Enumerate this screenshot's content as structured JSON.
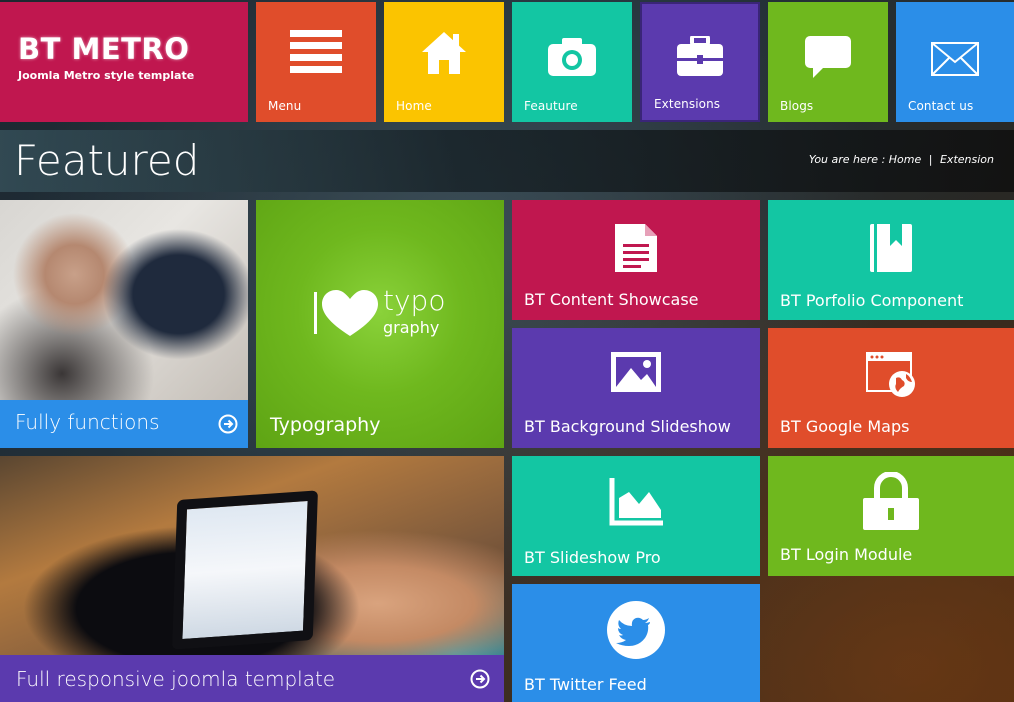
{
  "brand": {
    "title": "BT METRO",
    "subtitle": "Joomla Metro style template"
  },
  "nav": [
    {
      "label": "Menu",
      "icon": "menu-lines-icon",
      "color": "#e04d2b"
    },
    {
      "label": "Home",
      "icon": "home-icon",
      "color": "#fbc400"
    },
    {
      "label": "Feauture",
      "icon": "camera-icon",
      "color": "#13c6a3"
    },
    {
      "label": "Extensions",
      "icon": "briefcase-icon",
      "color": "#5b3aae"
    },
    {
      "label": "Blogs",
      "icon": "chat-bubble-icon",
      "color": "#6fb81e"
    },
    {
      "label": "Contact us",
      "icon": "envelope-icon",
      "color": "#2b8ee8"
    }
  ],
  "featured": {
    "title": "Featured",
    "breadcrumb_prefix": "You are here : Home",
    "breadcrumb_sep": "|",
    "breadcrumb_current": "Extension"
  },
  "tiles": {
    "fully_functions": "Fully functions",
    "typography": "Typography",
    "typography_art_top": "typo",
    "typography_art_bottom": "graphy",
    "responsive": "Full responsive joomla template"
  },
  "products": [
    {
      "label": "BT Content Showcase",
      "icon": "document-icon",
      "color": "#c0174f"
    },
    {
      "label": "BT Porfolio Component",
      "icon": "book-bookmark-icon",
      "color": "#13c6a3"
    },
    {
      "label": "BT Background Slideshow",
      "icon": "picture-icon",
      "color": "#5b3aae"
    },
    {
      "label": "BT Google Maps",
      "icon": "globe-window-icon",
      "color": "#e04d2b"
    },
    {
      "label": "BT Slideshow Pro",
      "icon": "area-chart-icon",
      "color": "#13c6a3"
    },
    {
      "label": "BT Login Module",
      "icon": "padlock-icon",
      "color": "#6fb81e"
    },
    {
      "label": "BT Twitter Feed",
      "icon": "twitter-bird-icon",
      "color": "#2b8ee8"
    }
  ],
  "colors": {
    "brand": "#c0174f",
    "blue": "#2b8ee8",
    "green": "#6fb81e",
    "purple": "#5b3aae"
  }
}
